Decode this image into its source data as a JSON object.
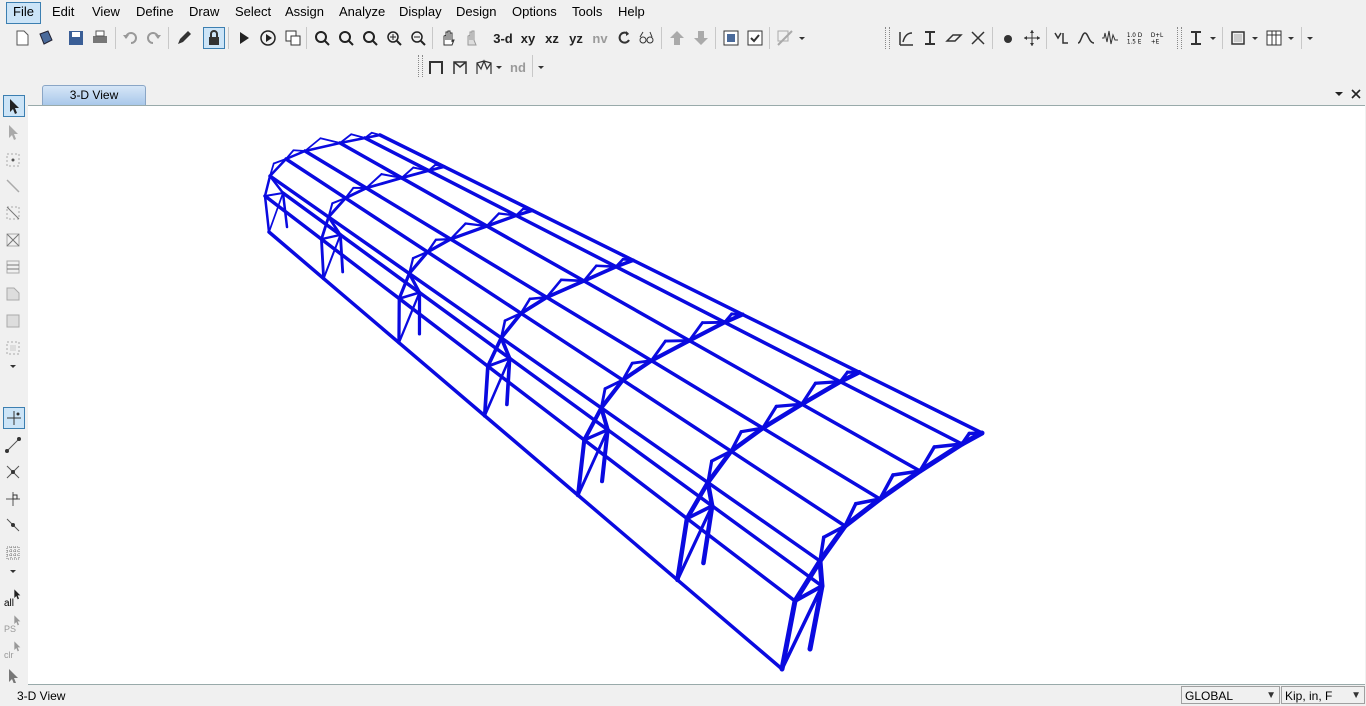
{
  "menu": [
    "File",
    "Edit",
    "View",
    "Define",
    "Draw",
    "Select",
    "Assign",
    "Analyze",
    "Display",
    "Design",
    "Options",
    "Tools",
    "Help"
  ],
  "toolbar": {
    "view_3d": "3-d",
    "view_xy": "xy",
    "view_xz": "xz",
    "view_yz": "yz",
    "view_nv": "nv",
    "nd_label": "nd"
  },
  "left_toolbar": {
    "select_all": "all",
    "select_previous": "PS",
    "clear_selection": "clr"
  },
  "tab": {
    "title": "3-D View"
  },
  "status": {
    "view_name": "3-D View",
    "coord_system": "GLOBAL",
    "units": "Kip, in, F"
  },
  "colors": {
    "frame": "#0a0ae0",
    "active_menu": "#cce4f7"
  },
  "model": {
    "description_none": "",
    "frame_count": 7
  }
}
